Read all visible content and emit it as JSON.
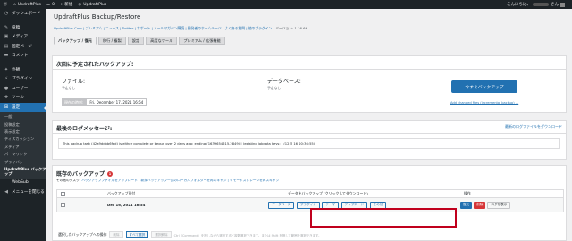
{
  "admin_bar": {
    "site_name": "UpdraftPlus",
    "comments_count": "0",
    "new_label": "+ 新規",
    "plugin_label": "UpdraftPlus",
    "greeting_prefix": "こんにちは、",
    "greeting_suffix": "さん",
    "icons": [
      "wordpress-logo-icon",
      "home-icon",
      "comment-icon",
      "plus-icon",
      "updraft-icon",
      "avatar-icon"
    ]
  },
  "sidebar": {
    "items": [
      {
        "label": "ダッシュボード",
        "icon": "dashboard-icon",
        "glyph": "◔"
      },
      {
        "label": "投稿",
        "icon": "pin-icon",
        "glyph": "✎"
      },
      {
        "label": "メディア",
        "icon": "media-icon",
        "glyph": "▣"
      },
      {
        "label": "固定ページ",
        "icon": "page-icon",
        "glyph": "▤"
      },
      {
        "label": "コメント",
        "icon": "comment-icon",
        "glyph": "▬"
      },
      {
        "label": "外観",
        "icon": "appearance-icon",
        "glyph": "✦"
      },
      {
        "label": "プラグイン",
        "icon": "plugin-icon",
        "glyph": "⚡"
      },
      {
        "label": "ユーザー",
        "icon": "user-icon",
        "glyph": "●"
      },
      {
        "label": "ツール",
        "icon": "tools-icon",
        "glyph": "✚"
      },
      {
        "label": "設定",
        "icon": "settings-icon",
        "glyph": "⊞"
      }
    ],
    "submenu": [
      "一般",
      "投稿設定",
      "表示設定",
      "ディスカッション",
      "メディア",
      "パーマリンク",
      "プライバシー",
      "UpdraftPlus バックアップ"
    ],
    "after": [
      {
        "label": "WebSub"
      },
      {
        "label": "メニューを閉じる",
        "icon": "collapse-icon",
        "glyph": "◀"
      }
    ]
  },
  "page": {
    "title": "UpdraftPlus Backup/Restore",
    "links": "UpdraftPlus.Com | プレミアム | ニュース | Twitter | サポート | メールマガジン購読 | 開発者のホームページ | よくある質問 | 他のプラグイン",
    "version": " - バージョン: 1.16.66",
    "tabs": [
      "バックアップ / 復元",
      "移行 / 複製",
      "設定",
      "高度なツール",
      "プレミアム / 拡張機能"
    ]
  },
  "next_backups": {
    "heading": "次回に予定されたバックアップ:",
    "files_label": "ファイル:",
    "files_value": "予定なし",
    "db_label": "データベース:",
    "db_value": "予定なし",
    "time_label": "現在の時刻:",
    "time_value": "Fri, December 17, 2021 16:54",
    "backup_now": "今すぐバックアップ",
    "changed_files_link": "Add changed files (incremental backup) ..."
  },
  "last_log": {
    "heading": "最後のログメッセージ:",
    "download_link": "最新のログファイルをダウンロード",
    "message": "This backup task (42a9ddbb6fed) is either complete or begun over 2 days ago: ending (1639654615.2849) | (existing jobdata keys: ) (12月 16 20:36:55)"
  },
  "existing": {
    "heading": "既存のバックアップ",
    "count": "1",
    "more_tasks_label": "その他のタスク: ",
    "more_tasks": "バックアップファイルをアップロード | 新規バックアップ一式のローカルフォルダーを再スキャン | リモートストレージを再スキャン",
    "col_date": "バックアップ日付",
    "col_data": "データをバックアップ (クリックしてダウンロード)",
    "col_actions": "操作",
    "row_date": "Dec 16, 2021 16:54",
    "download_buttons": [
      "データベース",
      "プラグイン",
      "テーマ",
      "アップロード",
      "その他"
    ],
    "action_buttons": [
      "復元",
      "削除",
      "ログを表示"
    ],
    "bulk_label": "選択したバックアップへの操作",
    "bulk_buttons": [
      "削除",
      "すべて選択",
      "選択解除"
    ],
    "bulk_hint": "Ctrl（Command）を押しながら選択すると複数選択できます。または Shift を押して範囲を選択できます。"
  }
}
